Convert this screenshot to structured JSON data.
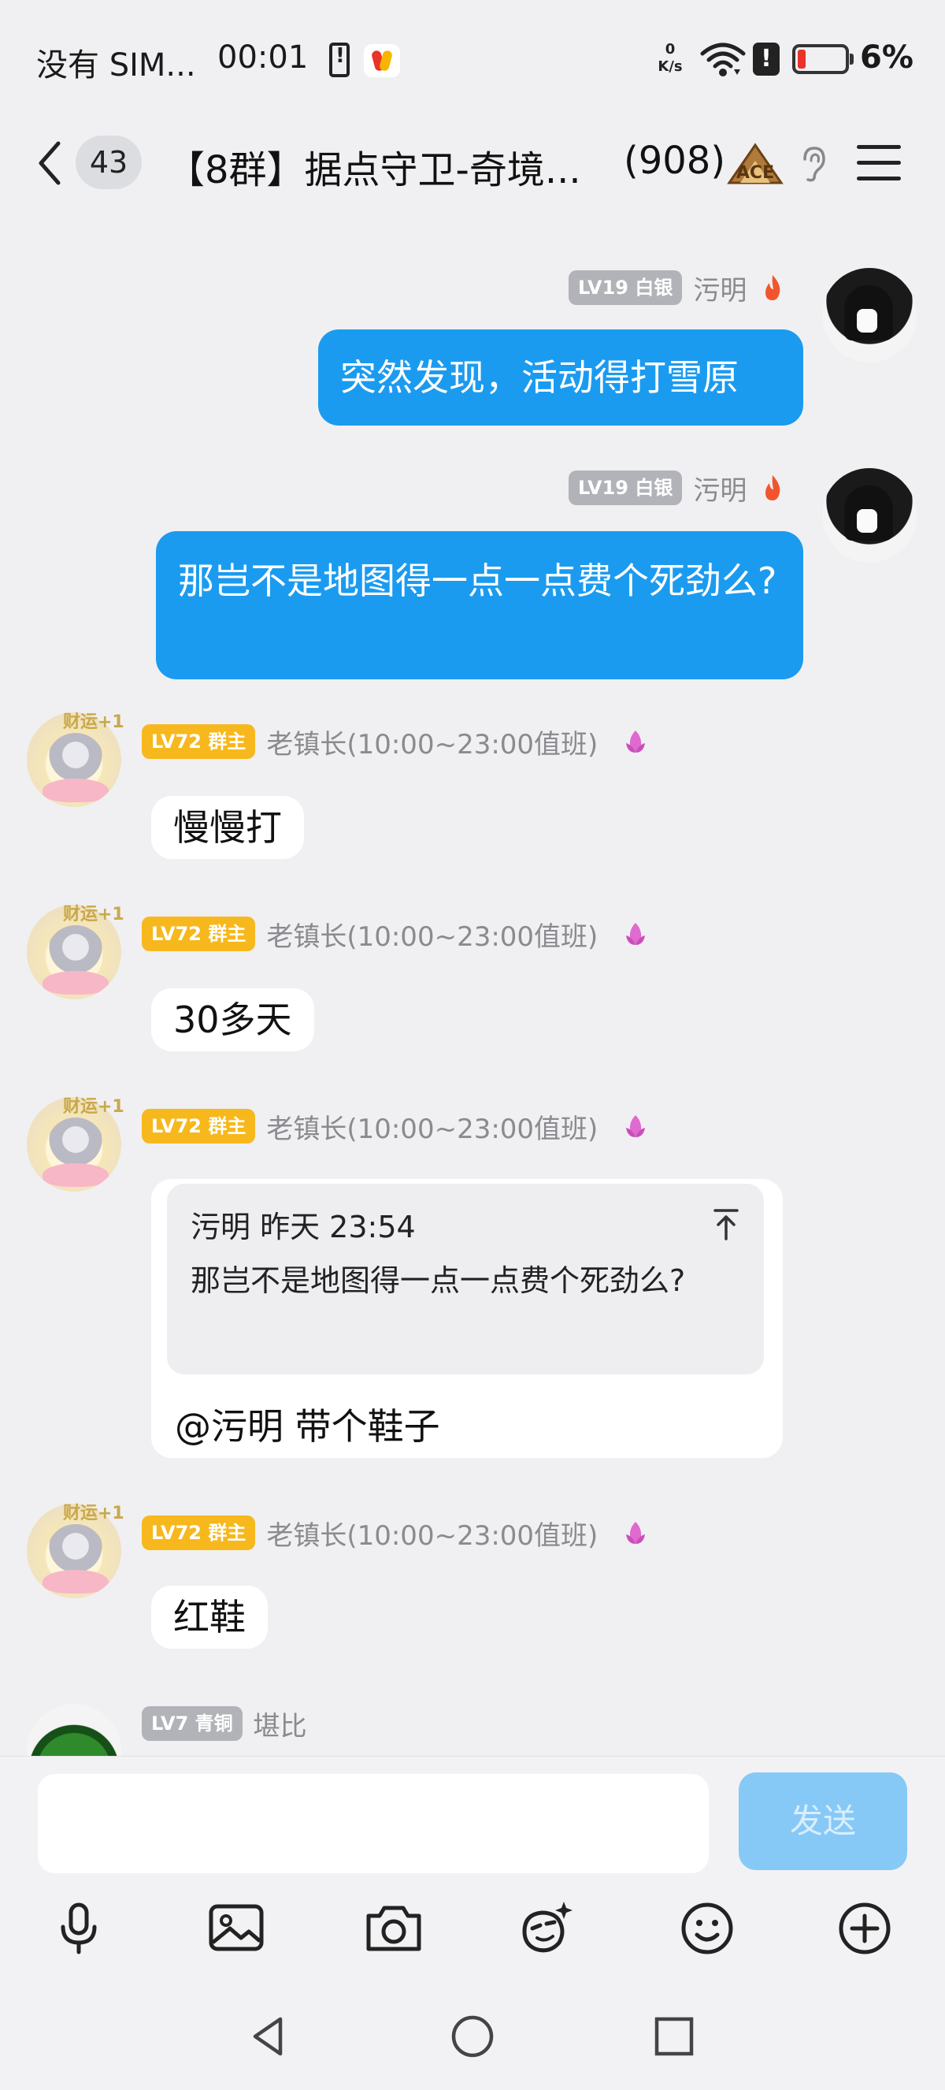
{
  "status_bar": {
    "carrier": "没有 SIM...",
    "time": "00:01",
    "net_speed_value": "0",
    "net_speed_unit": "K/s",
    "battery_percent": "6%",
    "battery_level": 0.06,
    "alert_glyph": "!"
  },
  "header": {
    "unread_count": "43",
    "title": "【8群】据点守卫-奇境...",
    "member_count": "(908)",
    "icons": [
      "back-icon",
      "ace-icon",
      "ear-icon",
      "menu-icon"
    ]
  },
  "messages": [
    {
      "side": "right",
      "level": "LV19 白银",
      "nickname": "污明",
      "text": "突然发现，活动得打雪原"
    },
    {
      "side": "right",
      "level": "LV19 白银",
      "nickname": "污明",
      "text": "那岂不是地图得一点一点费个死劲么?"
    },
    {
      "side": "left",
      "badge": "财运+1",
      "level": "LV72 群主",
      "nickname": "老镇长(10:00~23:00值班)",
      "text": "慢慢打"
    },
    {
      "side": "left",
      "badge": "财运+1",
      "level": "LV72 群主",
      "nickname": "老镇长(10:00~23:00值班)",
      "text": "30多天"
    },
    {
      "side": "left",
      "badge": "财运+1",
      "level": "LV72 群主",
      "nickname": "老镇长(10:00~23:00值班)",
      "quote": {
        "author": "污明 昨天 23:54",
        "text": "那岂不是地图得一点一点费个死劲么?"
      },
      "text": "@污明 带个鞋子"
    },
    {
      "side": "left",
      "badge": "财运+1",
      "level": "LV72 群主",
      "nickname": "老镇长(10:00~23:00值班)",
      "text": "红鞋"
    },
    {
      "side": "left",
      "level": "LV7 青铜",
      "nickname": "堪比",
      "text": ""
    }
  ],
  "input": {
    "placeholder": "",
    "send_label": "发送",
    "tools": [
      "microphone-icon",
      "image-icon",
      "camera-icon",
      "sticker-icon",
      "emoji-icon",
      "plus-icon"
    ]
  },
  "nav": {
    "buttons": [
      "back-triangle-icon",
      "home-circle-icon",
      "recents-square-icon"
    ]
  },
  "colors": {
    "background": "#f0f0f2",
    "my_bubble": "#1b9bf0",
    "send_button": "#86c9f7",
    "owner_tag": "#f7b81d",
    "silver_tag": "#b2b3b8"
  }
}
